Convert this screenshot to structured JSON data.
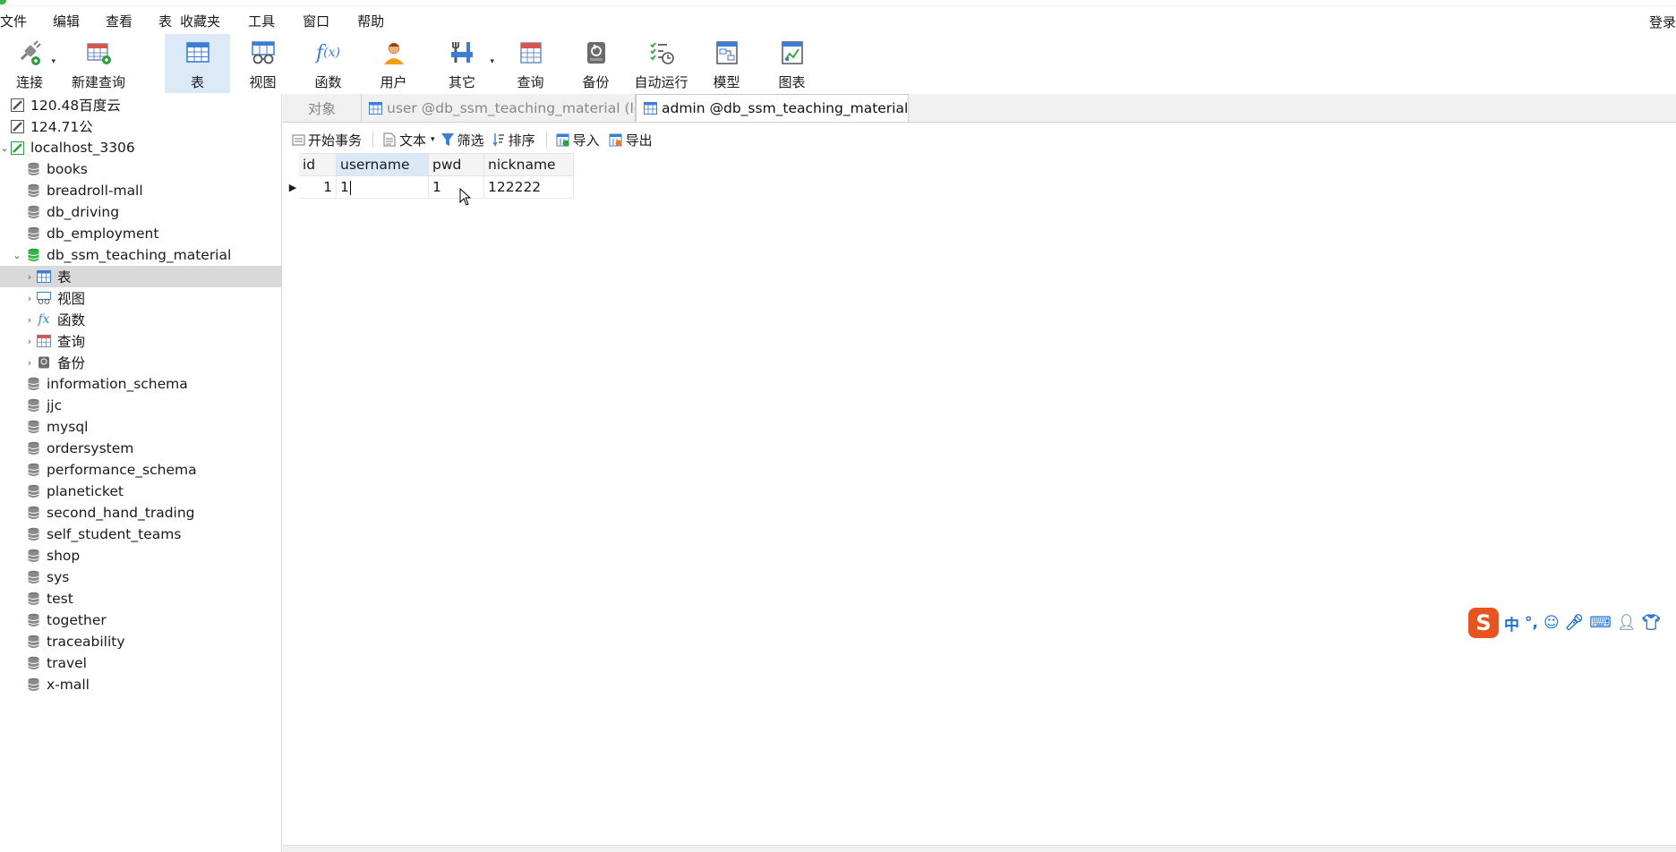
{
  "menu": [
    "文件",
    "编辑",
    "查看",
    "表",
    "收藏夹",
    "工具",
    "窗口",
    "帮助"
  ],
  "login_label": "登录",
  "toolbar": [
    {
      "label": "连接",
      "icon": "connect-icon",
      "dropdown": true
    },
    {
      "label": "新建查询",
      "icon": "new-query-icon"
    },
    {
      "label": "表",
      "icon": "table-icon",
      "active": true
    },
    {
      "label": "视图",
      "icon": "view-icon"
    },
    {
      "label": "函数",
      "icon": "function-icon"
    },
    {
      "label": "用户",
      "icon": "user-icon"
    },
    {
      "label": "其它",
      "icon": "tools-icon",
      "dropdown": true
    },
    {
      "label": "查询",
      "icon": "query-icon"
    },
    {
      "label": "备份",
      "icon": "backup-icon"
    },
    {
      "label": "自动运行",
      "icon": "autorun-icon"
    },
    {
      "label": "模型",
      "icon": "model-icon"
    },
    {
      "label": "图表",
      "icon": "chart-icon"
    }
  ],
  "tree": {
    "connections": [
      {
        "label": "120.48百度云"
      },
      {
        "label": "124.71公"
      },
      {
        "label": "localhost_3306"
      }
    ],
    "databases_before": [
      "books",
      "breadroll-mall",
      "db_driving",
      "db_employment"
    ],
    "open_db": "db_ssm_teaching_material",
    "open_db_children": [
      "表",
      "视图",
      "函数",
      "查询",
      "备份"
    ],
    "databases_after": [
      "information_schema",
      "jjc",
      "mysql",
      "ordersystem",
      "performance_schema",
      "planeticket",
      "second_hand_trading",
      "self_student_teams",
      "shop",
      "sys",
      "test",
      "together",
      "traceability",
      "travel",
      "x-mall"
    ]
  },
  "tabs": {
    "objects": "对象",
    "user_tab": "user @db_ssm_teaching_material (lo...",
    "admin_tab": "admin @db_ssm_teaching_material (..."
  },
  "subbar": {
    "begin_txn": "开始事务",
    "text": "文本",
    "filter": "筛选",
    "sort": "排序",
    "import": "导入",
    "export": "导出"
  },
  "grid": {
    "columns": [
      "id",
      "username",
      "pwd",
      "nickname"
    ],
    "rows": [
      {
        "id": "1",
        "username": "1",
        "pwd": "1",
        "nickname": "122222"
      }
    ]
  },
  "colors": {
    "accent": "#1e6fd0",
    "toolbar_active": "#dce9f7",
    "tree_selected": "#d9d9d9",
    "db_open_green": "#2e9e3e",
    "ime_orange": "#e8531f"
  }
}
